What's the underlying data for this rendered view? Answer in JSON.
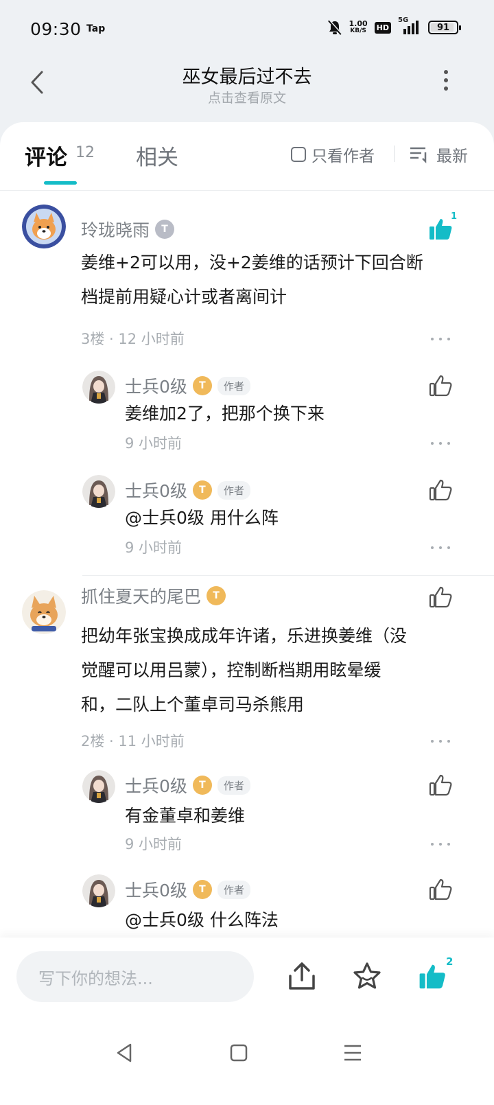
{
  "status": {
    "time": "09:30",
    "app_tag": "Tap",
    "net_speed_top": "1.00",
    "net_speed_bottom": "KB/S",
    "hd": "HD",
    "signal": "5G",
    "battery": "91",
    "battery_level": 0.91
  },
  "header": {
    "title": "巫女最后过不去",
    "subtitle": "点击查看原文"
  },
  "tabs": {
    "comments_label": "评论",
    "comments_count": "12",
    "related_label": "相关",
    "author_only_label": "只看作者",
    "sort_label": "最新"
  },
  "comments": [
    {
      "user": "玲珑晓雨",
      "level": "T",
      "content_line1": "姜维+2可以用，没+2姜维的话预计下回合断",
      "content_line2": "档提前用疑心计或者离间计",
      "meta": "3楼 · 12 小时前",
      "likes": "1",
      "replies": [
        {
          "user": "士兵0级",
          "level": "T",
          "tag": "作者",
          "content": "姜维加2了，把那个换下来",
          "meta": "9 小时前"
        },
        {
          "user": "士兵0级",
          "level": "T",
          "tag": "作者",
          "content": "@士兵0级  用什么阵",
          "meta": "9 小时前"
        }
      ]
    },
    {
      "user": "抓住夏天的尾巴",
      "level": "T",
      "content_line1": "把幼年张宝换成成年许诸，乐进换姜维（没",
      "content_line2": "觉醒可以用吕蒙），控制断档期用眩晕缓",
      "content_line3": "和，二队上个董卓司马杀熊用",
      "meta": "2楼 · 11 小时前",
      "replies": [
        {
          "user": "士兵0级",
          "level": "T",
          "tag": "作者",
          "content": "有金董卓和姜维",
          "meta": "9 小时前"
        },
        {
          "user": "士兵0级",
          "level": "T",
          "tag": "作者",
          "content": "@士兵0级  什么阵法"
        }
      ]
    }
  ],
  "bottom": {
    "input_placeholder": "写下你的想法...",
    "like_count": "2"
  },
  "colors": {
    "accent": "#14bcc7",
    "gold_badge": "#f0b95a",
    "silver_badge": "#b9bcc6"
  },
  "icons": [
    "back-icon",
    "more-icon",
    "checkbox-icon",
    "sort-icon",
    "thumb-up-icon",
    "share-icon",
    "star-icon",
    "triangle-back-icon",
    "square-home-icon",
    "menu-lines-icon"
  ]
}
